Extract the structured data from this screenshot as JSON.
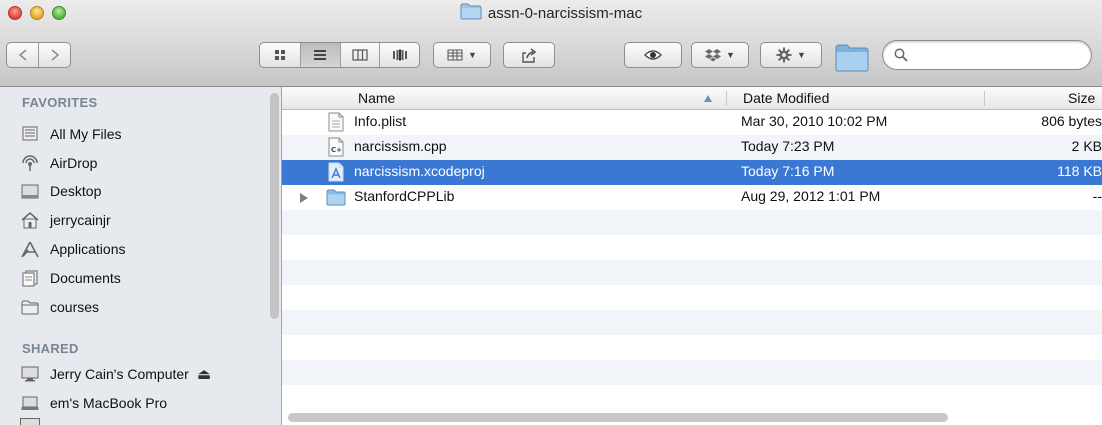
{
  "window": {
    "title": "assn-0-narcissism-mac"
  },
  "toolbar": {
    "back_icon": "chevron-left-icon",
    "forward_icon": "chevron-right-icon",
    "view_modes": [
      "icon-view",
      "list-view",
      "column-view",
      "cover-flow-view"
    ],
    "active_view": "list-view"
  },
  "sidebar": {
    "favorites_header": "FAVORITES",
    "favorites": [
      {
        "label": "All My Files",
        "icon": "all-files-icon"
      },
      {
        "label": "AirDrop",
        "icon": "airdrop-icon"
      },
      {
        "label": "Desktop",
        "icon": "desktop-icon"
      },
      {
        "label": "jerrycainjr",
        "icon": "home-icon"
      },
      {
        "label": "Applications",
        "icon": "applications-icon"
      },
      {
        "label": "Documents",
        "icon": "documents-icon"
      },
      {
        "label": "courses",
        "icon": "folder-icon"
      }
    ],
    "shared_header": "SHARED",
    "shared": [
      {
        "label": "Jerry Cain's Computer",
        "icon": "computer-icon",
        "eject": "⏏"
      },
      {
        "label": "em's MacBook Pro",
        "icon": "laptop-icon"
      }
    ]
  },
  "columns": {
    "name": "Name",
    "date": "Date Modified",
    "size": "Size"
  },
  "files": [
    {
      "name": "Info.plist",
      "date": "Mar 30, 2010 10:02 PM",
      "size": "806 bytes",
      "icon": "plist-file-icon",
      "selected": false
    },
    {
      "name": "narcissism.cpp",
      "date": "Today 7:23 PM",
      "size": "2 KB",
      "icon": "cpp-file-icon",
      "selected": false
    },
    {
      "name": "narcissism.xcodeproj",
      "date": "Today 7:16 PM",
      "size": "118 KB",
      "icon": "xcodeproj-icon",
      "selected": true
    },
    {
      "name": "StanfordCPPLib",
      "date": "Aug 29, 2012 1:01 PM",
      "size": "--",
      "icon": "folder-icon",
      "selected": false,
      "folder": true
    }
  ],
  "colors": {
    "selection": "#3a78d4",
    "sidebar_bg": "#e6eaef",
    "alt_row": "#f1f5fa"
  }
}
